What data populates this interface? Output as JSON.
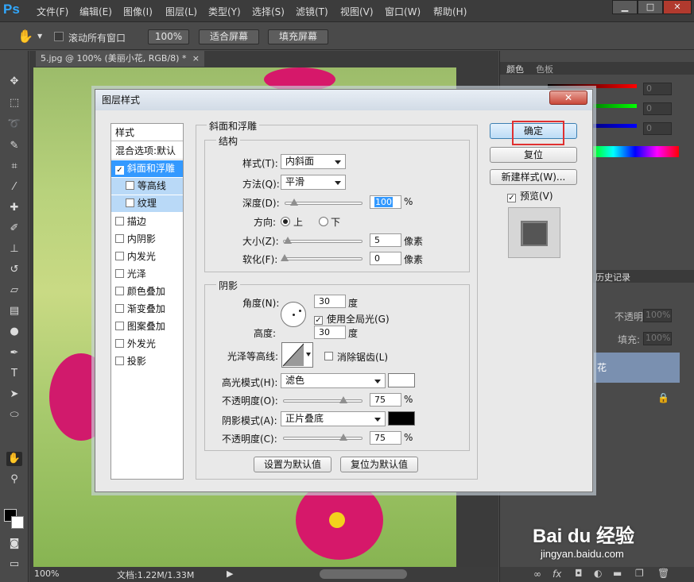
{
  "app": {
    "logo": "Ps"
  },
  "menu": [
    "文件(F)",
    "编辑(E)",
    "图像(I)",
    "图层(L)",
    "类型(Y)",
    "选择(S)",
    "滤镜(T)",
    "视图(V)",
    "窗口(W)",
    "帮助(H)"
  ],
  "window_controls": {
    "minimize": "▁",
    "maximize": "□",
    "close": "✕"
  },
  "options_bar": {
    "scroll_all_label": "滚动所有窗口",
    "zoom_btn": "100%",
    "fit_screen": "适合屏幕",
    "fill_screen": "填充屏幕"
  },
  "document": {
    "tab_title": "5.jpg @ 100% (美丽小花, RGB/8) *",
    "tab_close": "×"
  },
  "status": {
    "zoom": "100%",
    "doc_info": "文档:1.22M/1.33M"
  },
  "panels": {
    "color_tab": "颜色",
    "swatch_tab": "色板",
    "history_tab": "历史记录",
    "opacity_label": "不透明度:",
    "opacity_value": "100%",
    "fill_label": "填充:",
    "fill_value": "100%",
    "layer_name_fragment": "花",
    "slider_values": [
      "0",
      "0",
      "0"
    ]
  },
  "dialog": {
    "title": "图层样式",
    "close": "✕",
    "style_list_header": "样式",
    "style_items": [
      {
        "label": "混合选项:默认",
        "checkbox": false,
        "selected": false
      },
      {
        "label": "斜面和浮雕",
        "checkbox": true,
        "checked": true,
        "selected": true
      },
      {
        "label": "等高线",
        "checkbox": true,
        "checked": false,
        "sub": true
      },
      {
        "label": "纹理",
        "checkbox": true,
        "checked": false,
        "sub": true
      },
      {
        "label": "描边",
        "checkbox": true,
        "checked": false
      },
      {
        "label": "内阴影",
        "checkbox": true,
        "checked": false
      },
      {
        "label": "内发光",
        "checkbox": true,
        "checked": false
      },
      {
        "label": "光泽",
        "checkbox": true,
        "checked": false
      },
      {
        "label": "颜色叠加",
        "checkbox": true,
        "checked": false
      },
      {
        "label": "渐变叠加",
        "checkbox": true,
        "checked": false
      },
      {
        "label": "图案叠加",
        "checkbox": true,
        "checked": false
      },
      {
        "label": "外发光",
        "checkbox": true,
        "checked": false
      },
      {
        "label": "投影",
        "checkbox": true,
        "checked": false
      }
    ],
    "section_title": "斜面和浮雕",
    "structure": {
      "title": "结构",
      "style_label": "样式(T):",
      "style_value": "内斜面",
      "method_label": "方法(Q):",
      "method_value": "平滑",
      "depth_label": "深度(D):",
      "depth_value": "100",
      "depth_unit": "%",
      "direction_label": "方向:",
      "dir_up": "上",
      "dir_down": "下",
      "size_label": "大小(Z):",
      "size_value": "5",
      "size_unit": "像素",
      "soften_label": "软化(F):",
      "soften_value": "0",
      "soften_unit": "像素"
    },
    "shading": {
      "title": "阴影",
      "angle_label": "角度(N):",
      "angle_value": "30",
      "angle_unit": "度",
      "global_light_label": "使用全局光(G)",
      "altitude_label": "高度:",
      "altitude_value": "30",
      "altitude_unit": "度",
      "gloss_contour_label": "光泽等高线:",
      "anti_alias_label": "消除锯齿(L)",
      "highlight_mode_label": "高光模式(H):",
      "highlight_mode_value": "滤色",
      "highlight_opacity_label": "不透明度(O):",
      "highlight_opacity_value": "75",
      "shadow_mode_label": "阴影模式(A):",
      "shadow_mode_value": "正片叠底",
      "shadow_opacity_label": "不透明度(C):",
      "shadow_opacity_value": "75",
      "percent": "%"
    },
    "buttons": {
      "make_default": "设置为默认值",
      "reset_default": "复位为默认值",
      "ok": "确定",
      "reset": "复位",
      "new_style": "新建样式(W)...",
      "preview": "预览(V)"
    }
  },
  "watermark": {
    "brand": "Bai du 经验",
    "url": "jingyan.baidu.com"
  },
  "colors": {
    "highlight_box": "#e03030",
    "selected_item": "#3399ff",
    "ok_button": "#cfe6fb"
  }
}
